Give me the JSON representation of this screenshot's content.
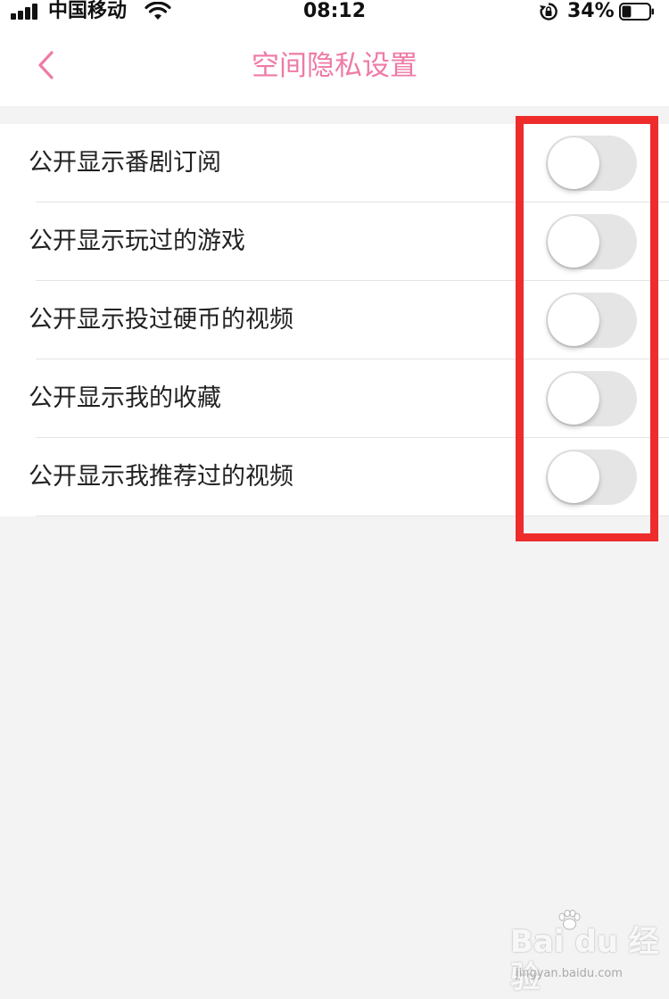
{
  "status_bar": {
    "carrier": "中国移动",
    "time": "08:12",
    "battery_percent": "34%",
    "battery_level": 0.34,
    "icons": [
      "signal-icon",
      "wifi-icon",
      "rotation-lock-icon",
      "battery-icon"
    ]
  },
  "nav": {
    "title": "空间隐私设置",
    "back_icon": "chevron-left-icon"
  },
  "colors": {
    "accent": "#ef7aa6",
    "highlight": "#ee2c2c",
    "toggle_off": "#e5e5e5",
    "background": "#f3f3f3"
  },
  "settings": {
    "items": [
      {
        "label": "公开显示番剧订阅",
        "enabled": false
      },
      {
        "label": "公开显示玩过的游戏",
        "enabled": false
      },
      {
        "label": "公开显示投过硬币的视频",
        "enabled": false
      },
      {
        "label": "公开显示我的收藏",
        "enabled": false
      },
      {
        "label": "公开显示我推荐过的视频",
        "enabled": false
      }
    ]
  },
  "watermark": {
    "main": "Bai du 经验",
    "sub": "jingyan.baidu.com"
  }
}
